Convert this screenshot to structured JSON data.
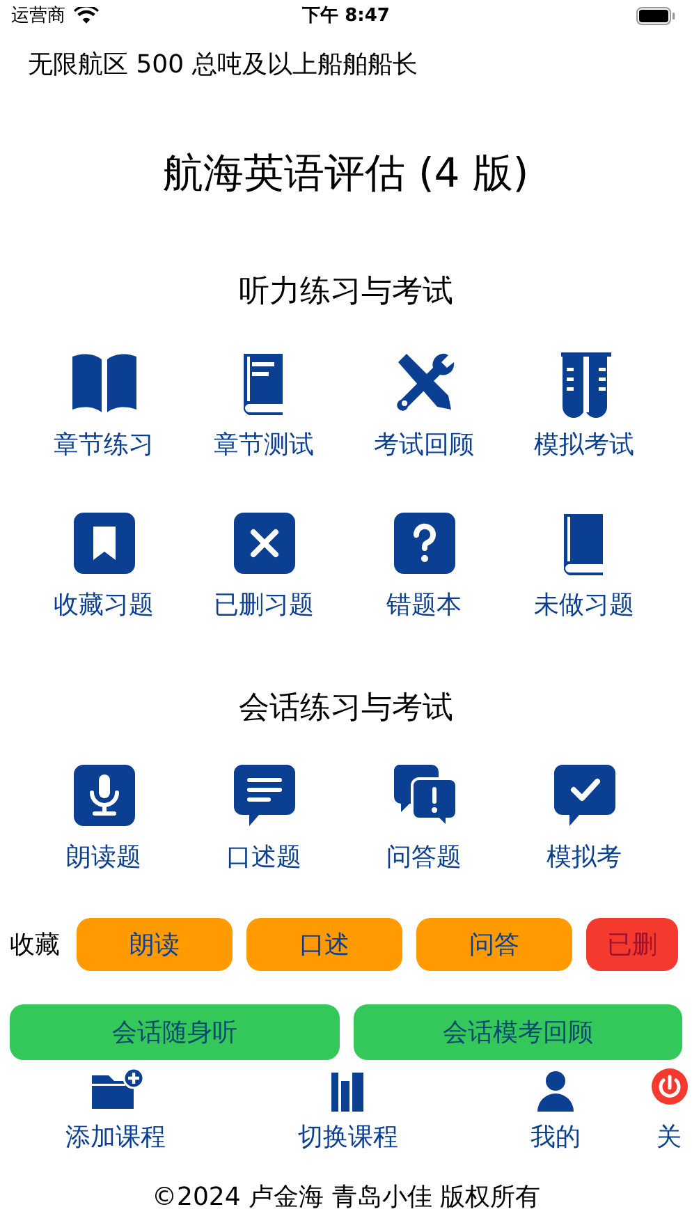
{
  "status_bar": {
    "carrier": "运营商",
    "time": "下午 8:47"
  },
  "course": "无限航区 500 总吨及以上船舶船长",
  "title": "航海英语评估 (4 版)",
  "listening": {
    "heading": "听力练习与考试",
    "items": [
      {
        "kind": "open-book",
        "label": "章节练习"
      },
      {
        "kind": "book",
        "label": "章节测试"
      },
      {
        "kind": "tools",
        "label": "考试回顾"
      },
      {
        "kind": "tubes",
        "label": "模拟考试"
      },
      {
        "kind": "bookmark",
        "label": "收藏习题"
      },
      {
        "kind": "cross",
        "label": "已删习题"
      },
      {
        "kind": "question",
        "label": "错题本"
      },
      {
        "kind": "plain-book",
        "label": "未做习题"
      }
    ]
  },
  "speaking": {
    "heading": "会话练习与考试",
    "items": [
      {
        "kind": "mic",
        "label": "朗读题"
      },
      {
        "kind": "chat",
        "label": "口述题"
      },
      {
        "kind": "chats",
        "label": "问答题"
      },
      {
        "kind": "check-chat",
        "label": "模拟考"
      }
    ]
  },
  "favorites": {
    "label": "收藏",
    "buttons": [
      {
        "label": "朗读",
        "color": "#ff9a00"
      },
      {
        "label": "口述",
        "color": "#ff9a00"
      },
      {
        "label": "问答",
        "color": "#ff9a00"
      },
      {
        "label": "已删",
        "color": "#f43a2f"
      }
    ]
  },
  "green_buttons": [
    "会话随身听",
    "会话模考回顾"
  ],
  "nav": [
    {
      "kind": "add-folder",
      "label": "添加课程"
    },
    {
      "kind": "books",
      "label": "切换课程"
    },
    {
      "kind": "person",
      "label": "我的"
    },
    {
      "kind": "power",
      "label": "关"
    }
  ],
  "footer": "©2024 卢金海 青岛小佳 版权所有"
}
